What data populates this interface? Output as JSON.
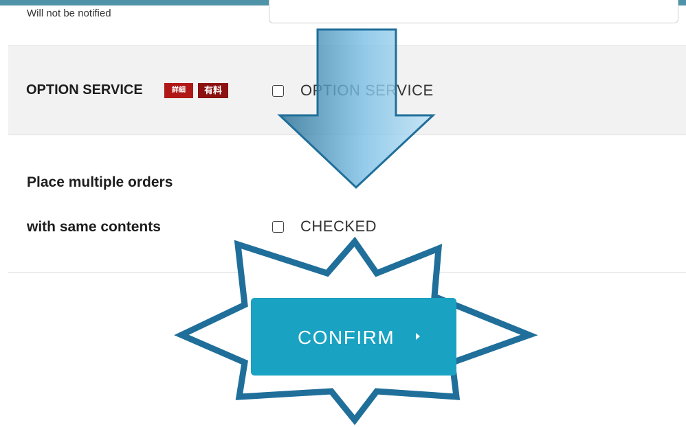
{
  "header_hint": "Will not be notified",
  "option_row": {
    "label": "OPTION SERVICE",
    "tag_detail": "詳細",
    "tag_paid": "有料",
    "checkbox_label": "OPTION SERVICE",
    "checked": false
  },
  "multi_order_row": {
    "label_line1": "Place multiple orders",
    "label_line2": "with same contents",
    "checkbox_label": "CHECKED",
    "checked": false
  },
  "confirm_button": {
    "label": "CONFIRM"
  },
  "colors": {
    "accent": "#1aa2c2",
    "tag_red": "#8c1111",
    "annotation_outline": "#1f6f9a",
    "annotation_fill": "#6fb7dd"
  }
}
